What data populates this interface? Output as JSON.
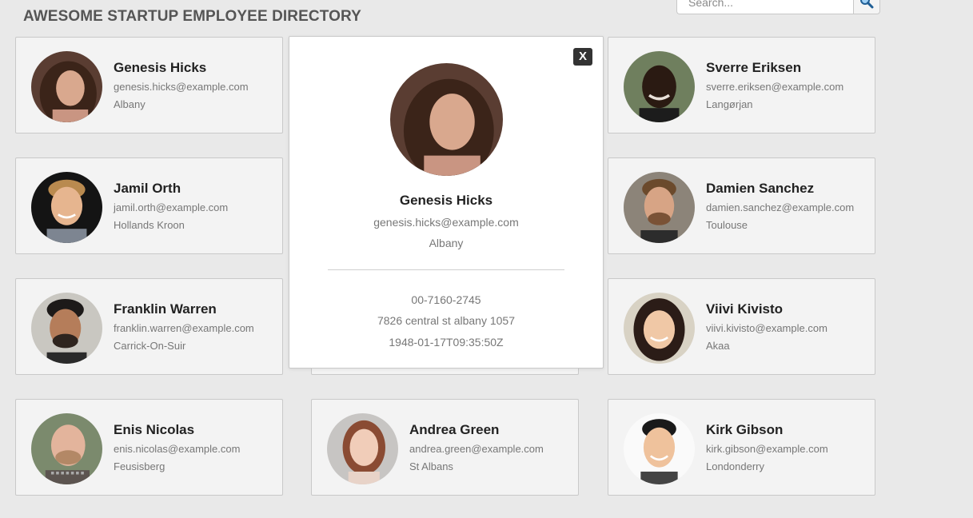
{
  "header": {
    "title": "AWESOME STARTUP EMPLOYEE DIRECTORY"
  },
  "search": {
    "placeholder": "Search...",
    "button_icon": "search-icon"
  },
  "employees": [
    {
      "name": "Genesis Hicks",
      "email": "genesis.hicks@example.com",
      "city": "Albany"
    },
    {
      "name": "Sverre Eriksen",
      "email": "sverre.eriksen@example.com",
      "city": "Langørjan"
    },
    {
      "name": "Jamil Orth",
      "email": "jamil.orth@example.com",
      "city": "Hollands Kroon"
    },
    {
      "name": "Damien Sanchez",
      "email": "damien.sanchez@example.com",
      "city": "Toulouse"
    },
    {
      "name": "Franklin Warren",
      "email": "franklin.warren@example.com",
      "city": "Carrick-On-Suir"
    },
    {
      "name": "Viivi Kivisto",
      "email": "viivi.kivisto@example.com",
      "city": "Akaa"
    },
    {
      "name": "Enis Nicolas",
      "email": "enis.nicolas@example.com",
      "city": "Feusisberg"
    },
    {
      "name": "Andrea Green",
      "email": "andrea.green@example.com",
      "city": "St Albans"
    },
    {
      "name": "Kirk Gibson",
      "email": "kirk.gibson@example.com",
      "city": "Londonderry"
    }
  ],
  "modal": {
    "close_label": "X",
    "name": "Genesis Hicks",
    "email": "genesis.hicks@example.com",
    "city": "Albany",
    "phone": "00-7160-2745",
    "address": "7826 central st albany 1057",
    "birthday": "1948-01-17T09:35:50Z"
  },
  "colors": {
    "page_background": "#e9e9e9",
    "card_background": "#f3f3f3",
    "close_button": "#333333"
  }
}
